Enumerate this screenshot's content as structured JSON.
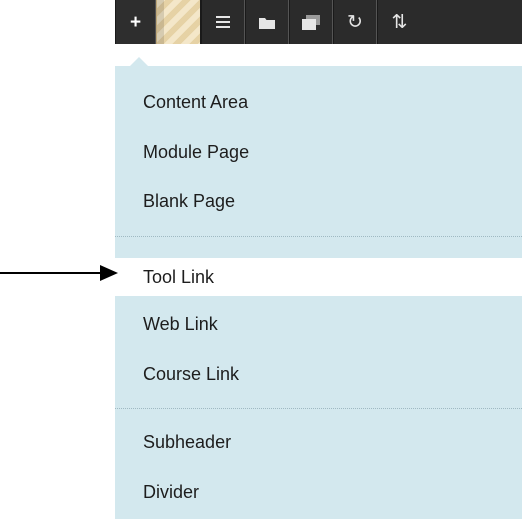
{
  "toolbar": {
    "buttons": [
      {
        "name": "add-menu-item",
        "icon": "plus-icon",
        "glyph": "+"
      },
      {
        "name": "course-theme",
        "icon": "pattern-swatch-icon"
      },
      {
        "name": "list-view",
        "icon": "list-icon",
        "glyph": "≡"
      },
      {
        "name": "folder-view",
        "icon": "folder-icon"
      },
      {
        "name": "window-view",
        "icon": "window-icon"
      },
      {
        "name": "refresh",
        "icon": "refresh-icon",
        "glyph": "↻"
      },
      {
        "name": "sort",
        "icon": "sort-arrows-icon",
        "glyph": "⇅"
      }
    ]
  },
  "menu": {
    "group1": [
      "Content Area",
      "Module Page",
      "Blank Page"
    ],
    "group2": [
      "Tool Link",
      "Web Link",
      "Course Link"
    ],
    "group3": [
      "Subheader",
      "Divider"
    ],
    "selected": "Tool Link"
  },
  "colors": {
    "toolbar_bg": "#2b2b2b",
    "menu_bg": "#d3e8ee",
    "selected_bg": "#ffffff",
    "text": "#1d1d1d"
  }
}
